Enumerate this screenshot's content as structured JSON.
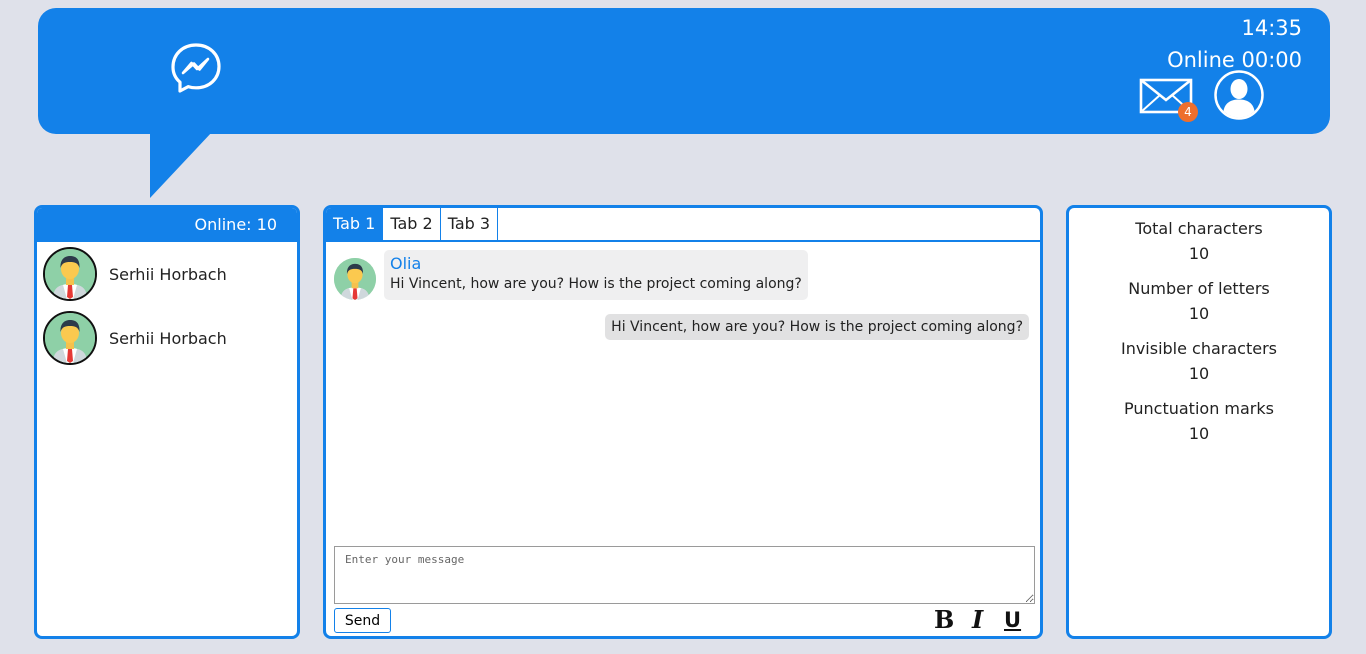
{
  "header": {
    "time": "14:35",
    "online_timer": "Online 00:00",
    "unread_count": "4",
    "logo_icon": "messenger-icon",
    "mail_icon": "mail-icon",
    "avatar_icon": "user-avatar-icon",
    "accent_color": "#1381e9",
    "badge_color": "#ee6f2d"
  },
  "sidebar": {
    "online_label": "Online: 10",
    "contacts": [
      {
        "name": "Serhii Horbach"
      },
      {
        "name": "Serhii Horbach"
      }
    ]
  },
  "chat": {
    "tabs": [
      {
        "label": "Tab 1",
        "active": true
      },
      {
        "label": "Tab 2",
        "active": false
      },
      {
        "label": "Tab 3",
        "active": false
      }
    ],
    "incoming": {
      "sender": "Olia",
      "text": "Hi Vincent, how are you? How is the project coming along?"
    },
    "outgoing": {
      "text": "Hi Vincent, how are you? How is the project coming along?"
    },
    "composer": {
      "placeholder": "Enter your message",
      "value": ""
    },
    "send_label": "Send",
    "format": {
      "bold": "B",
      "italic": "I",
      "underline": "U"
    }
  },
  "stats": [
    {
      "label": "Total characters",
      "value": "10"
    },
    {
      "label": "Number of letters",
      "value": "10"
    },
    {
      "label": "Invisible characters",
      "value": "10"
    },
    {
      "label": "Punctuation marks",
      "value": "10"
    }
  ]
}
